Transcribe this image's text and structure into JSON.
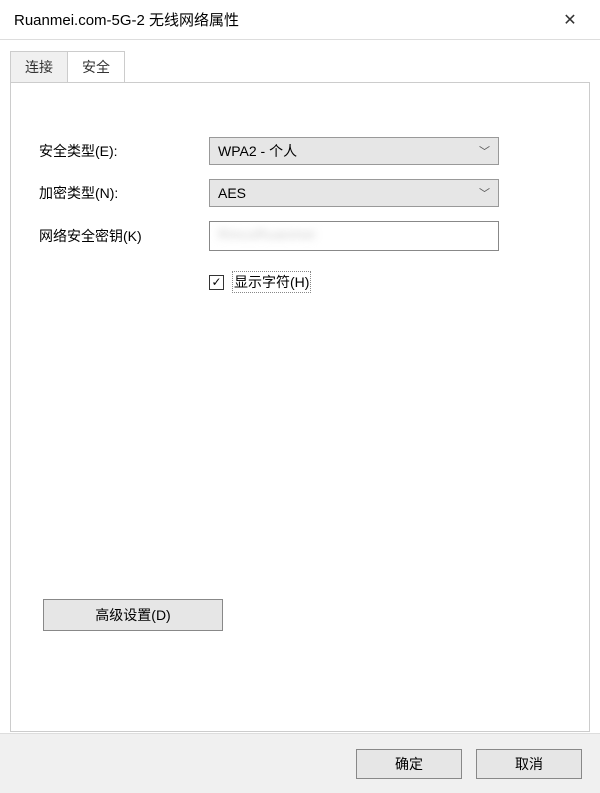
{
  "window": {
    "title": "Ruanmei.com-5G-2 无线网络属性"
  },
  "tabs": {
    "connection": "连接",
    "security": "安全"
  },
  "labels": {
    "securityType": "安全类型(E):",
    "encryptionType": "加密类型(N):",
    "networkKey": "网络安全密钥(K)",
    "showChars": "显示字符(H)",
    "advanced": "高级设置(D)"
  },
  "values": {
    "securityType": "WPA2 - 个人",
    "encryptionType": "AES",
    "networkKey": "RincoRuanmei"
  },
  "checkbox": {
    "showCharsChecked": "✓"
  },
  "buttons": {
    "ok": "确定",
    "cancel": "取消"
  }
}
